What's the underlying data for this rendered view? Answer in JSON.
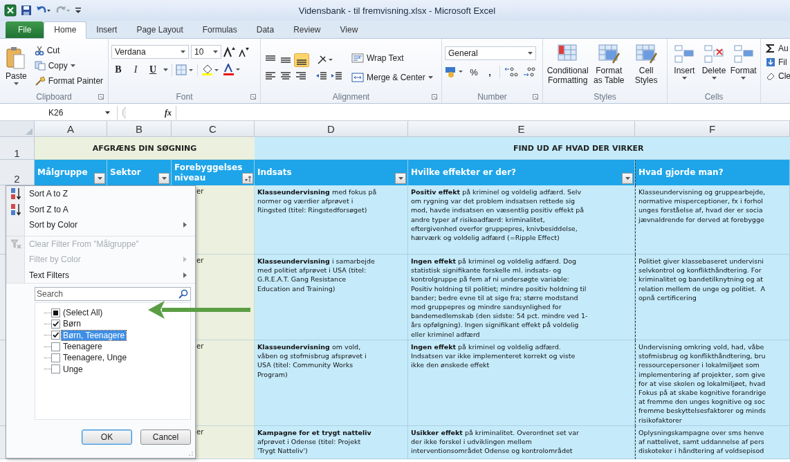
{
  "window": {
    "title": "Vidensbank - til fremvisning.xlsx  -  Microsoft Excel"
  },
  "ribbon_tabs": [
    {
      "label": "File",
      "kind": "file",
      "selected": false
    },
    {
      "label": "Home",
      "kind": "tab",
      "selected": true
    },
    {
      "label": "Insert",
      "kind": "tab",
      "selected": false
    },
    {
      "label": "Page Layout",
      "kind": "tab",
      "selected": false
    },
    {
      "label": "Formulas",
      "kind": "tab",
      "selected": false
    },
    {
      "label": "Data",
      "kind": "tab",
      "selected": false
    },
    {
      "label": "Review",
      "kind": "tab",
      "selected": false
    },
    {
      "label": "View",
      "kind": "tab",
      "selected": false
    }
  ],
  "clipboard": {
    "paste": "Paste",
    "cut": "Cut",
    "copy": "Copy",
    "format_painter": "Format Painter",
    "label": "Clipboard"
  },
  "font": {
    "name": "Verdana",
    "size": "10",
    "styles": [
      "B",
      "I",
      "U"
    ],
    "label": "Font"
  },
  "alignment": {
    "wrap": "Wrap Text",
    "merge": "Merge & Center",
    "label": "Alignment"
  },
  "number": {
    "format": "General",
    "percent": "%",
    "comma": ",",
    "label": "Number"
  },
  "styles": {
    "buttons": [
      "Conditional\nFormatting",
      "Format\nas Table",
      "Cell\nStyles"
    ],
    "label": "Styles"
  },
  "cells": {
    "buttons": [
      "Insert",
      "Delete",
      "Format"
    ],
    "label": "Cells"
  },
  "editing": {
    "items": [
      "Au",
      "Fil",
      "Cle"
    ]
  },
  "formula_bar": {
    "name_box": "K26",
    "fx": "fx"
  },
  "sheet": {
    "column_headers": [
      "A",
      "B",
      "C",
      "D",
      "E",
      "F"
    ],
    "row_numbers": [
      "1",
      "2"
    ],
    "banner_left": "AFGRÆNS DIN SØGNING",
    "banner_right": "FIND UD AF HVAD DER VIRKER",
    "columns": [
      {
        "label": "Målgruppe",
        "kind": "filter"
      },
      {
        "label": "Sektor",
        "kind": "filter"
      },
      {
        "label": "Forebyggelses niveau",
        "kind": "sorted"
      },
      {
        "label": "Indsats",
        "kind": "filter"
      },
      {
        "label": "Hvilke effekter er der?",
        "kind": "filter"
      },
      {
        "label": "Hvad gjorde man?",
        "kind": "none"
      }
    ],
    "rows": [
      {
        "niveau": "er",
        "indsats": "**Klasseundervisning** med fokus på\nnormer og værdier afprøvet i\nRingsted (titel: Ringstedforsøget)",
        "effekt": "**Positiv effekt** på kriminel og voldelig adfærd. Selv\nom rygning var det problem indsatsen rettede sig\nmod, havde indsatsen en væsentlig positiv effekt på\nandre typer af risikoadfærd: kriminalitet,\neftergivenhed overfor gruppepres, knivbesiddelse,\nhærværk og voldelig adfærd (=Ripple Effect)",
        "hvad": "Klasseundervisning og gruppearbejde,\nnormative misperceptioner, fx i forhol\nunges forståelse af, hvad der er socia\njævnaldrende for derved at forebygge"
      },
      {
        "niveau": "er",
        "indsats": "**Klasseundervisning** i samarbejde\nmed politiet afprøvet i USA (titel:\nG.R.E.A.T. Gang Resistance\nEducation and Training)",
        "effekt": "**Ingen effekt** på kriminel og voldelig adfærd. Dog\nstatistisk signifikante forskelle ml. indsats- og\nkontrolgruppe på fem af ni undersøgte variable:\nPositiv holdning til politiet; mindre positiv holdning til\nbander; bedre evne til at sige fra; større modstand\nmod gruppepres og mindre sandsynlighed for\nbandemedlemskab (den sidste: 54 pct. mindre ved 1-\nårs opfølgning). Ingen signifikant effekt på voldelig\neller kriminel adfærd",
        "hvad": "Politiet giver klassebaseret undervisni\nselvkontrol og konflikthåndtering. For\nkriminalitet og bandetilknytning og at\nrelation mellem de unge og politiet.  A\nopnå certificering"
      },
      {
        "niveau": "er",
        "indsats": "**Klasseundervisning** om vold,\nvåben og stofmisbrug afsprøvet i\nUSA (titel: Community Works\nProgram)",
        "effekt": "**Ingen effekt** på kriminel og voldelig adfærd.\nIndsatsen var ikke implementeret korrekt og viste\nikke den ønskede effekt",
        "hvad": "Undervisning omkring vold, had, våbe\nstofmisbrug og konflikthåndtering, bru\nressourcepersoner i lokalmiljøet som\nimplementering af projekter, som give\nfor at vise skolen og lokalmiljøet, hvad\nFokus på at skabe kognitive forandrige\nat fremme den unges kognitive og soc\nfremme beskyttelsesfaktorer og minds\nrisikofaktorer"
      },
      {
        "niveau": "er",
        "indsats": "**Kampagne for et trygt natteliv**\nafprøvet i Odense (titel: Projekt\n'Trygt Natteliv')",
        "effekt": "**Usikker effekt** på kriminalitet. Overordnet set var\nder ikke forskel i udviklingen mellem\ninterventionsområdet Odense og kontrolområdet",
        "hvad": "Oplysningskampagne over sms henve\naf nattelivet, samt uddannelse af pers\ndiskoteker i håndtering af voldsepisod"
      }
    ]
  },
  "filter_menu": {
    "items": [
      {
        "label": "Sort A to Z",
        "kind": "sort_az",
        "disabled": false,
        "submenu": false
      },
      {
        "label": "Sort Z to A",
        "kind": "sort_za",
        "disabled": false,
        "submenu": false
      },
      {
        "label": "Sort by Color",
        "kind": "plain",
        "disabled": false,
        "submenu": true
      },
      {
        "label": "Clear Filter From \"Målgruppe\"",
        "kind": "clear",
        "disabled": true,
        "submenu": false
      },
      {
        "label": "Filter by Color",
        "kind": "plain",
        "disabled": true,
        "submenu": true
      },
      {
        "label": "Text Filters",
        "kind": "plain",
        "disabled": false,
        "submenu": true
      }
    ],
    "search": {
      "placeholder": "Search"
    },
    "values": [
      {
        "label": "(Select All)",
        "checked": false,
        "partial": true,
        "selected": false
      },
      {
        "label": "Børn",
        "checked": true,
        "partial": false,
        "selected": false
      },
      {
        "label": "Børn, Teenagere",
        "checked": true,
        "partial": false,
        "selected": true
      },
      {
        "label": "Teenagere",
        "checked": false,
        "partial": false,
        "selected": false
      },
      {
        "label": "Teenagere, Unge",
        "checked": false,
        "partial": false,
        "selected": false
      },
      {
        "label": "Unge",
        "checked": false,
        "partial": false,
        "selected": false
      }
    ],
    "buttons": [
      {
        "label": "OK",
        "focused": true
      },
      {
        "label": "Cancel",
        "focused": false
      }
    ]
  }
}
